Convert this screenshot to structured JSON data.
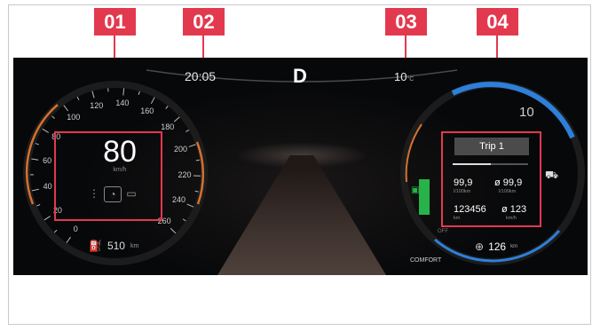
{
  "callouts": [
    "01",
    "02",
    "03",
    "04"
  ],
  "header": {
    "time": "20:05",
    "gear": "D",
    "temperature": "10",
    "temperature_unit": "°C"
  },
  "speedometer": {
    "speed": "80",
    "speed_unit": "km/h",
    "scale_labels": [
      "0",
      "20",
      "40",
      "60",
      "80",
      "100",
      "120",
      "140",
      "160",
      "180",
      "200",
      "220",
      "240",
      "260"
    ],
    "icons": [
      "lane-assist-icon",
      "driver-assist-icon",
      "traffic-sign-icon"
    ]
  },
  "range": {
    "value": "510",
    "unit": "km",
    "icon": "fuel-pump-icon"
  },
  "trip": {
    "title": "Trip 1",
    "progress": 0.5,
    "consumption": {
      "value": "99,9",
      "unit": "l/100km"
    },
    "avg_consumption": {
      "value": "ø 99,9",
      "unit": "l/100km"
    },
    "distance": {
      "value": "123456",
      "unit": "km"
    },
    "avg_speed": {
      "value": "ø 123",
      "unit": "km/h"
    }
  },
  "power_meter": {
    "top_label": "10",
    "off_label": "OFF",
    "mode": "COMFORT",
    "icons": [
      "battery-icon",
      "car-icon"
    ]
  },
  "electric_range": {
    "value": "126",
    "unit": "km",
    "icon": "charge-plug-icon"
  },
  "colors": {
    "accent": "#e2394f",
    "blue_ring": "#2e7fd9",
    "orange_ring": "#d5702e",
    "green_bar": "#27b34a"
  }
}
